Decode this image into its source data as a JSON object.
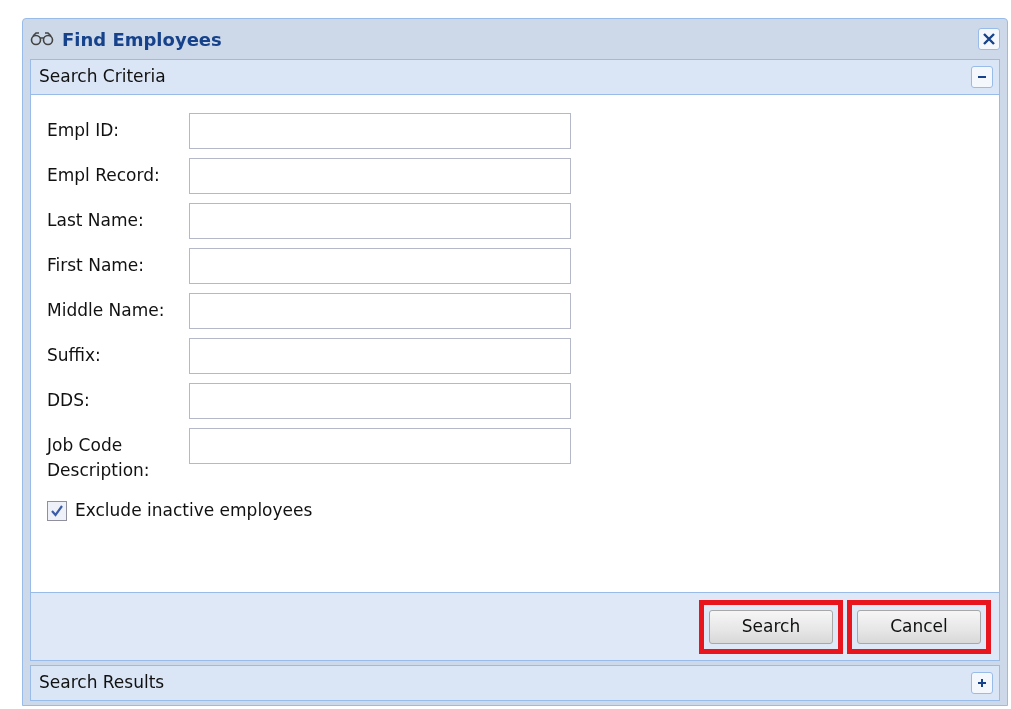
{
  "window": {
    "title": "Find Employees"
  },
  "criteria_panel": {
    "title": "Search Criteria",
    "expanded": true,
    "fields": [
      {
        "label": "Empl ID:"
      },
      {
        "label": "Empl Record:"
      },
      {
        "label": "Last Name:"
      },
      {
        "label": "First Name:"
      },
      {
        "label": "Middle Name:"
      },
      {
        "label": "Suffix:"
      },
      {
        "label": "DDS:"
      },
      {
        "label": "Job Code Description:"
      }
    ],
    "checkbox": {
      "label": "Exclude inactive employees",
      "checked": true
    }
  },
  "buttons": [
    {
      "label": "Search",
      "highlighted": true
    },
    {
      "label": "Cancel",
      "highlighted": true
    }
  ],
  "results_panel": {
    "title": "Search Results",
    "expanded": false
  }
}
